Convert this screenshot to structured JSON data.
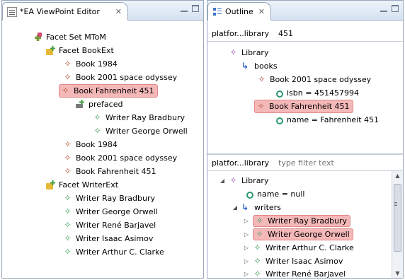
{
  "left_view": {
    "tab_title": "*EA ViewPoint Editor",
    "tree": [
      {
        "label": "Facet Set MToM",
        "icon": "facet-set-icon"
      },
      {
        "label": "Facet BookExt",
        "icon": "facet-icon"
      },
      {
        "label": "Book 1984",
        "icon": "book-icon"
      },
      {
        "label": "Book 2001 space odyssey",
        "icon": "book-icon"
      },
      {
        "label": "Book Fahrenheit 451",
        "icon": "book-icon",
        "selected": true
      },
      {
        "label": "prefaced",
        "icon": "reference-icon"
      },
      {
        "label": "Writer Ray Bradbury",
        "icon": "writer-icon"
      },
      {
        "label": "Writer George Orwell",
        "icon": "writer-icon"
      },
      {
        "label": "Book 1984",
        "icon": "book-icon"
      },
      {
        "label": "Book 2001 space odyssey",
        "icon": "book-icon"
      },
      {
        "label": "Book Fahrenheit 451",
        "icon": "book-icon"
      },
      {
        "label": "Facet WriterExt",
        "icon": "facet-icon"
      },
      {
        "label": "Writer Ray Bradbury",
        "icon": "writer-icon"
      },
      {
        "label": "Writer George Orwell",
        "icon": "writer-icon"
      },
      {
        "label": "Writer René Barjavel",
        "icon": "writer-icon"
      },
      {
        "label": "Writer Isaac Asimov",
        "icon": "writer-icon"
      },
      {
        "label": "Writer Arthur C. Clarke",
        "icon": "writer-icon"
      }
    ]
  },
  "right_view": {
    "tab_title": "Outline",
    "top_breadcrumb": {
      "label": "platfor...library",
      "value": "451"
    },
    "top_tree": [
      {
        "label": "Library",
        "icon": "class-icon"
      },
      {
        "label": "books",
        "icon": "reference-icon"
      },
      {
        "label": "Book 2001 space odyssey",
        "icon": "book-icon"
      },
      {
        "label": "isbn = 451457994",
        "icon": "attribute-icon"
      },
      {
        "label": "Book Fahrenheit 451",
        "icon": "book-icon",
        "selected": true
      },
      {
        "label": "name = Fahrenheit 451",
        "icon": "attribute-icon"
      }
    ],
    "bottom_breadcrumb": {
      "label": "platfor...library",
      "placeholder": "type filter text"
    },
    "bottom_tree": [
      {
        "label": "Library",
        "icon": "class-icon",
        "expander": "expanded"
      },
      {
        "label": "name = null",
        "icon": "attribute-icon"
      },
      {
        "label": "writers",
        "icon": "reference-icon",
        "expander": "expanded"
      },
      {
        "label": "Writer Ray Bradbury",
        "icon": "writer-icon",
        "expander": "collapsed",
        "selected": true
      },
      {
        "label": "Writer George Orwell",
        "icon": "writer-icon",
        "expander": "collapsed",
        "selected": true
      },
      {
        "label": "Writer Arthur C. Clarke",
        "icon": "writer-icon",
        "expander": "collapsed"
      },
      {
        "label": "Writer Isaac Asimov",
        "icon": "writer-icon",
        "expander": "collapsed"
      },
      {
        "label": "Writer René Barjavel",
        "icon": "writer-icon",
        "expander": "collapsed"
      }
    ]
  },
  "colors": {
    "selection_fill": "#f5b8b8",
    "selection_border": "#e08989",
    "book_icon": "#b0523a",
    "writer_icon": "#3f9f5d",
    "class_icon": "#a05ab8",
    "reference_icon": "#2961c9"
  }
}
